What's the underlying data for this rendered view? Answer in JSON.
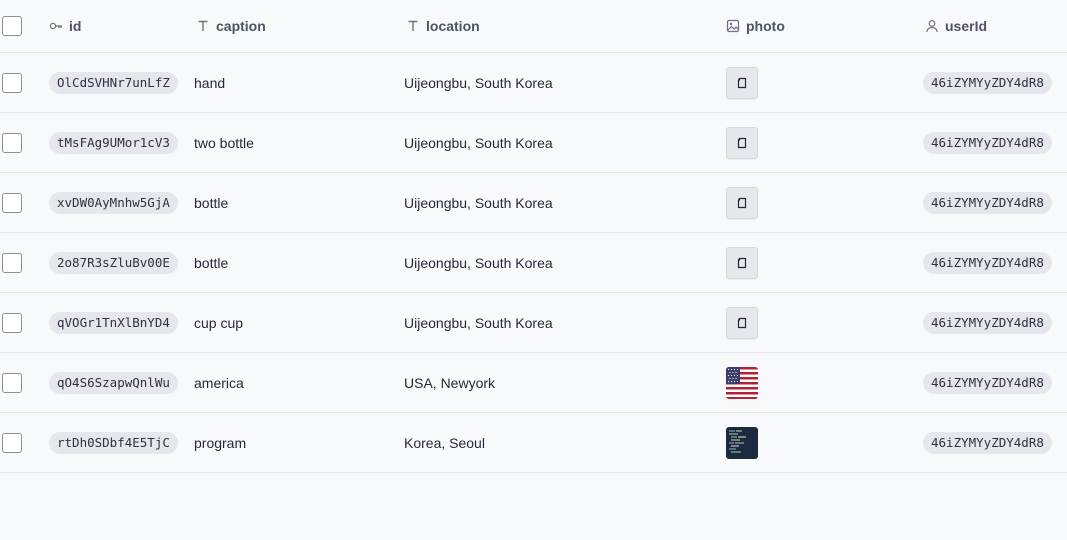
{
  "columns": {
    "id": "id",
    "caption": "caption",
    "location": "location",
    "photo": "photo",
    "userId": "userId"
  },
  "icons": {
    "id_col": "key-icon",
    "caption_col": "text-icon",
    "location_col": "text-icon",
    "photo_col": "image-icon",
    "userId_col": "user-icon",
    "photo_placeholder": "document-icon"
  },
  "rows": [
    {
      "id": "OlCdSVHNr7unLfZ",
      "caption": "hand",
      "location": "Uijeongbu, South Korea",
      "photo": "document-icon",
      "userId": "46iZYMYyZDY4dR8"
    },
    {
      "id": "tMsFAg9UMor1cV3",
      "caption": "two bottle",
      "location": "Uijeongbu, South Korea",
      "photo": "document-icon",
      "userId": "46iZYMYyZDY4dR8"
    },
    {
      "id": "xvDW0AyMnhw5GjA",
      "caption": "bottle",
      "location": "Uijeongbu, South Korea",
      "photo": "document-icon",
      "userId": "46iZYMYyZDY4dR8"
    },
    {
      "id": "2o87R3sZluBv00E",
      "caption": "bottle",
      "location": "Uijeongbu, South Korea",
      "photo": "document-icon",
      "userId": "46iZYMYyZDY4dR8"
    },
    {
      "id": "qVOGr1TnXlBnYD4",
      "caption": "cup cup",
      "location": "Uijeongbu, South Korea",
      "photo": "document-icon",
      "userId": "46iZYMYyZDY4dR8"
    },
    {
      "id": "qO4S6SzapwQnlWu",
      "caption": "america",
      "location": "USA, Newyork",
      "photo": "us-flag-image",
      "userId": "46iZYMYyZDY4dR8"
    },
    {
      "id": "rtDh0SDbf4E5TjC",
      "caption": "program",
      "location": "Korea, Seoul",
      "photo": "code-screenshot-image",
      "userId": "46iZYMYyZDY4dR8"
    }
  ]
}
